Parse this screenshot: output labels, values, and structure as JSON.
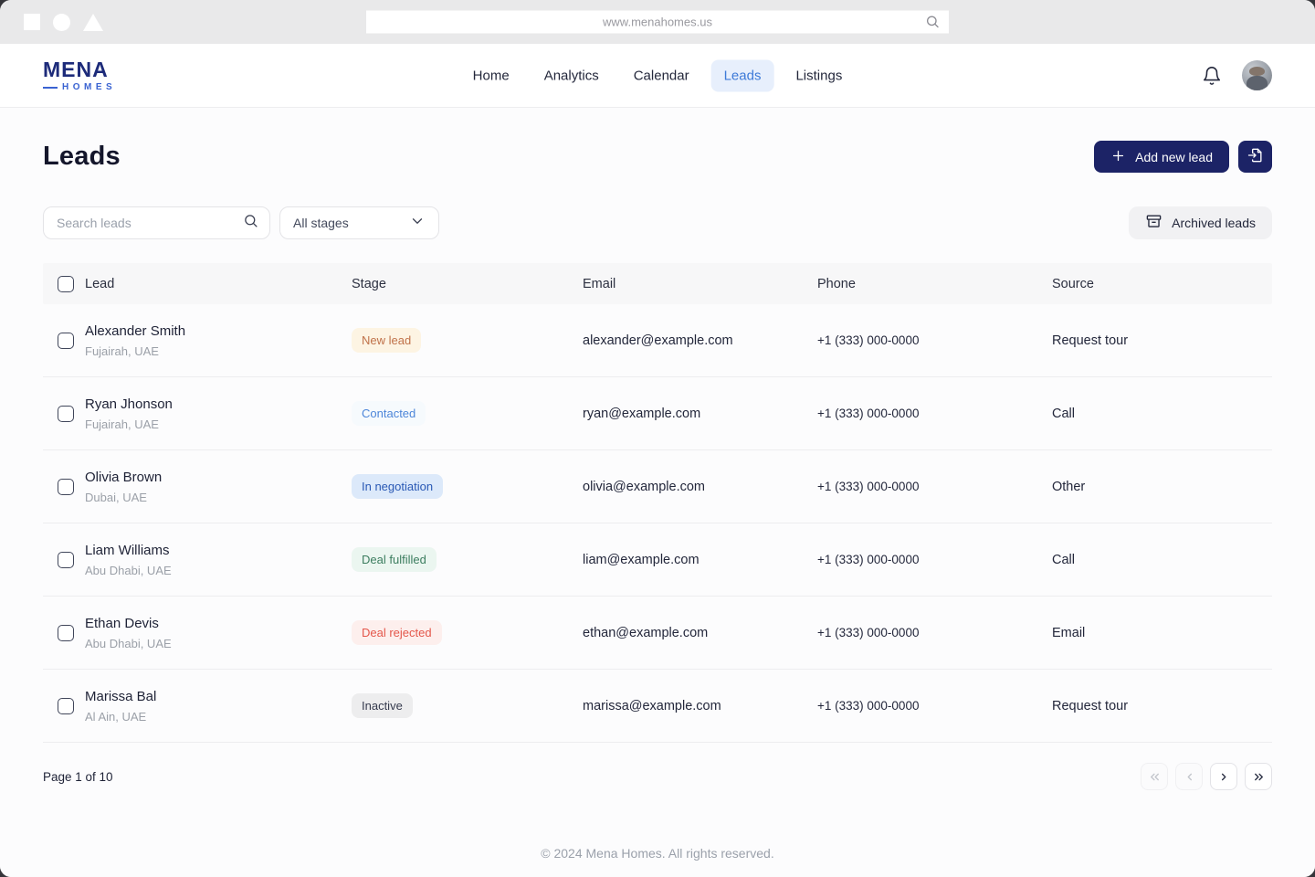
{
  "browser": {
    "url": "www.menahomes.us"
  },
  "header": {
    "logo": {
      "line1": "MENA",
      "line2": "HOMES"
    },
    "nav": [
      {
        "label": "Home",
        "active": false
      },
      {
        "label": "Analytics",
        "active": false
      },
      {
        "label": "Calendar",
        "active": false
      },
      {
        "label": "Leads",
        "active": true
      },
      {
        "label": "Listings",
        "active": false
      }
    ]
  },
  "page": {
    "title": "Leads",
    "add_button_label": "Add new lead",
    "archived_button_label": "Archived leads",
    "search_placeholder": "Search leads",
    "stage_filter_value": "All stages"
  },
  "table": {
    "headers": [
      "Lead",
      "Stage",
      "Email",
      "Phone",
      "Source"
    ],
    "rows": [
      {
        "name": "Alexander Smith",
        "location": "Fujairah, UAE",
        "stage": "New lead",
        "stage_key": "new-lead",
        "email": "alexander@example.com",
        "phone": "+1 (333) 000-0000",
        "source": "Request tour"
      },
      {
        "name": "Ryan Jhonson",
        "location": "Fujairah, UAE",
        "stage": "Contacted",
        "stage_key": "contacted",
        "email": "ryan@example.com",
        "phone": "+1 (333) 000-0000",
        "source": "Call"
      },
      {
        "name": "Olivia Brown",
        "location": "Dubai, UAE",
        "stage": "In negotiation",
        "stage_key": "in-negotiation",
        "email": "olivia@example.com",
        "phone": "+1 (333) 000-0000",
        "source": "Other"
      },
      {
        "name": "Liam Williams",
        "location": "Abu Dhabi, UAE",
        "stage": "Deal fulfilled",
        "stage_key": "deal-fulfilled",
        "email": "liam@example.com",
        "phone": "+1 (333) 000-0000",
        "source": "Call"
      },
      {
        "name": "Ethan Devis",
        "location": "Abu Dhabi, UAE",
        "stage": "Deal rejected",
        "stage_key": "deal-rejected",
        "email": "ethan@example.com",
        "phone": "+1 (333) 000-0000",
        "source": "Email"
      },
      {
        "name": "Marissa Bal",
        "location": "Al Ain, UAE",
        "stage": "Inactive",
        "stage_key": "inactive",
        "email": "marissa@example.com",
        "phone": "+1 (333) 000-0000",
        "source": "Request tour"
      }
    ]
  },
  "pagination": {
    "label": "Page 1 of 10"
  },
  "footer": {
    "copyright": "© 2024 Mena Homes. All rights reserved."
  },
  "icons": {
    "chrome": [
      "square-shape",
      "circle-shape",
      "triangle-shape"
    ],
    "url_search": "magnifier",
    "bell": "notification-bell-outline",
    "add": "plus",
    "import": "document-with-arrow",
    "search": "magnifier",
    "stage_dropdown": "chevron-down",
    "archived": "archive-box",
    "pager": [
      "double-chevron-left",
      "chevron-left",
      "chevron-right",
      "double-chevron-right"
    ]
  },
  "colors": {
    "navy": "#1c2366",
    "brand": "#1d2b7a",
    "brand2": "#3a63d2",
    "nav_active_bg": "#e7effc",
    "nav_active_text": "#3d7ad8",
    "badges": {
      "new-lead": {
        "bg": "#fdf4e3",
        "text": "#c0724a"
      },
      "contacted": {
        "bg": "#f6fafd",
        "text": "#4d86d9"
      },
      "in-negotiation": {
        "bg": "#dce9fa",
        "text": "#2a59b5"
      },
      "deal-fulfilled": {
        "bg": "#ebf6f0",
        "text": "#3c7d5f"
      },
      "deal-rejected": {
        "bg": "#fdefed",
        "text": "#e4574b"
      },
      "inactive": {
        "bg": "#ededee",
        "text": "#363b4e"
      }
    }
  }
}
